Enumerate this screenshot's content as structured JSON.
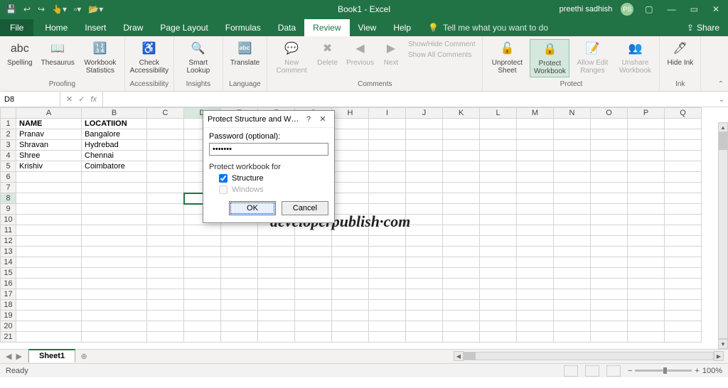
{
  "titlebar": {
    "title": "Book1 - Excel",
    "user": "preethi sadhish",
    "avatar": "PS"
  },
  "menu": {
    "file": "File",
    "tabs": [
      "Home",
      "Insert",
      "Draw",
      "Page Layout",
      "Formulas",
      "Data",
      "Review",
      "View",
      "Help"
    ],
    "active": "Review",
    "tell": "Tell me what you want to do",
    "share": "Share"
  },
  "ribbon": {
    "groups": {
      "proofing": {
        "label": "Proofing",
        "spelling": "Spelling",
        "thesaurus": "Thesaurus",
        "stats": "Workbook Statistics"
      },
      "accessibility": {
        "label": "Accessibility",
        "check": "Check Accessibility"
      },
      "insights": {
        "label": "Insights",
        "smart": "Smart Lookup"
      },
      "language": {
        "label": "Language",
        "translate": "Translate"
      },
      "comments": {
        "label": "Comments",
        "new": "New Comment",
        "delete": "Delete",
        "prev": "Previous",
        "next": "Next",
        "showhide": "Show/Hide Comment",
        "showall": "Show All Comments"
      },
      "protect": {
        "label": "Protect",
        "unprotect": "Unprotect Sheet",
        "protectwb": "Protect Workbook",
        "allowedit": "Allow Edit Ranges",
        "unshare": "Unshare Workbook"
      },
      "ink": {
        "label": "Ink",
        "hide": "Hide Ink"
      }
    }
  },
  "formulabar": {
    "cell": "D8",
    "fx": "fx"
  },
  "sheet": {
    "columns": [
      "A",
      "B",
      "C",
      "D",
      "E",
      "F",
      "G",
      "H",
      "I",
      "J",
      "K",
      "L",
      "M",
      "N",
      "O",
      "P",
      "Q"
    ],
    "headers": {
      "A": "NAME",
      "B": "LOCATIION"
    },
    "rows": [
      {
        "A": "Pranav",
        "B": "Bangalore"
      },
      {
        "A": "Shravan",
        "B": "Hydrebad"
      },
      {
        "A": "Shree",
        "B": "Chennai"
      },
      {
        "A": "Krishiv",
        "B": "Coimbatore"
      }
    ],
    "rowCount": 21,
    "selected": {
      "row": 8,
      "col": "D"
    }
  },
  "dialog": {
    "title": "Protect Structure and W…",
    "passwordLabel": "Password (optional):",
    "passwordValue": "•••••••",
    "protectFor": "Protect workbook for",
    "structure": "Structure",
    "windows": "Windows",
    "ok": "OK",
    "cancel": "Cancel"
  },
  "sheettabs": {
    "active": "Sheet1"
  },
  "statusbar": {
    "ready": "Ready",
    "zoom": "100%"
  },
  "watermark": "developerpublish·com"
}
